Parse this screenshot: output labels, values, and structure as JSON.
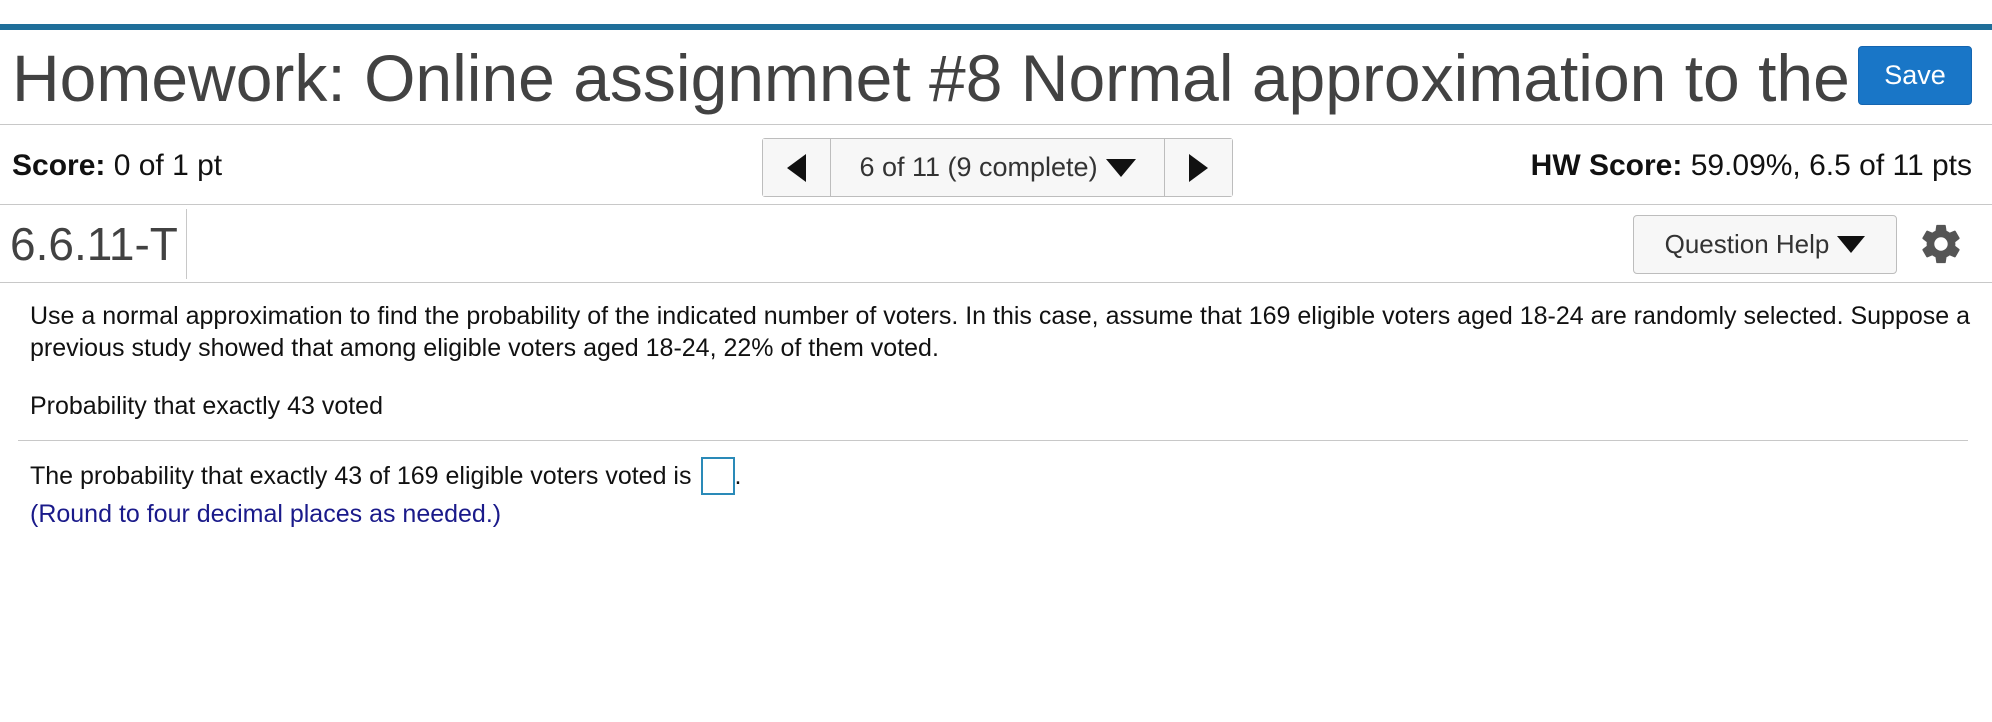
{
  "header": {
    "title": "Homework: Online assignmnet #8 Normal approximation to the",
    "save_label": "Save"
  },
  "score_bar": {
    "score_label": "Score:",
    "score_value": "0 of 1 pt",
    "navigator_text": "6 of 11 (9 complete)",
    "hw_score_label": "HW Score:",
    "hw_score_value": "59.09%, 6.5 of 11 pts"
  },
  "question_bar": {
    "question_id": "6.6.11-T",
    "help_label": "Question Help"
  },
  "problem": {
    "text": "Use a normal approximation to find the probability of the indicated number of voters. In this case, assume that 169 eligible voters aged 18-24 are randomly selected. Suppose a previous study showed that among eligible voters aged 18-24, 22% of them voted.",
    "subquestion": "Probability that exactly 43 voted"
  },
  "answer": {
    "prompt": "The probability that exactly 43 of 169 eligible voters voted is",
    "suffix": ".",
    "value": "",
    "note": "(Round to four decimal places as needed.)"
  },
  "colors": {
    "accent_bar": "#1f6f9a",
    "save_button": "#1976c7",
    "note_text": "#1a1a8a",
    "answer_box_border": "#2a8ab8"
  },
  "icons": {
    "prev": "triangle-left-icon",
    "next": "triangle-right-icon",
    "dropdown": "caret-down-icon",
    "settings": "gear-icon"
  }
}
